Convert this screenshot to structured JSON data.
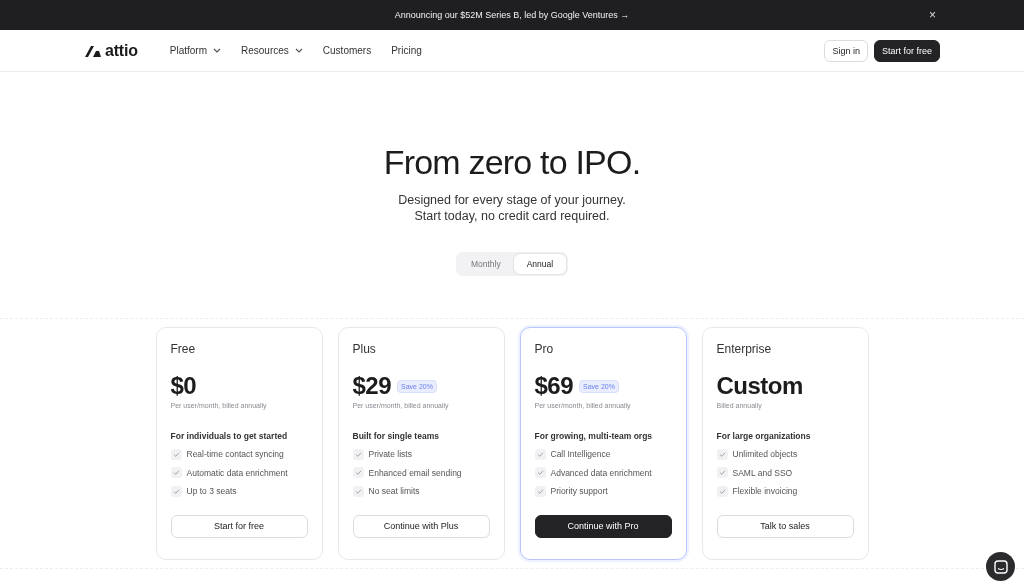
{
  "announcement": {
    "text": "Announcing our $52M Series B, led by Google Ventures",
    "arrow": "→",
    "close": "×"
  },
  "nav": {
    "logo": "attio",
    "items": [
      {
        "label": "Platform",
        "dropdown": true
      },
      {
        "label": "Resources",
        "dropdown": true
      },
      {
        "label": "Customers",
        "dropdown": false
      },
      {
        "label": "Pricing",
        "dropdown": false
      }
    ],
    "buttons": [
      {
        "label": "Sign in",
        "kind": "outline"
      },
      {
        "label": "Start for free",
        "kind": "primary"
      }
    ]
  },
  "hero": {
    "title": "From zero to IPO.",
    "subtitle_lines": [
      "Designed for every stage of your journey.",
      "Start today, no credit card required."
    ]
  },
  "billing_toggle": [
    {
      "label": "Monthly",
      "selected": false
    },
    {
      "label": "Annual",
      "selected": true
    }
  ],
  "plans": [
    {
      "name": "Free",
      "price": "$0",
      "billing": "Per user/month, billed annually",
      "featured": false,
      "tagline": "For individuals to get started",
      "features": [
        "Real-time contact syncing",
        "Automatic data enrichment",
        "Up to 3 seats"
      ],
      "button": {
        "label": "Start for free",
        "kind": "outline"
      }
    },
    {
      "name": "Plus",
      "price": "$29",
      "badge": "Save 20%",
      "billing": "Per user/month, billed annually",
      "featured": false,
      "tagline": "Built for single teams",
      "features": [
        "Private lists",
        "Enhanced email sending",
        "No seat limits"
      ],
      "button": {
        "label": "Continue with Plus",
        "kind": "outline"
      }
    },
    {
      "name": "Pro",
      "price": "$69",
      "badge": "Save 20%",
      "billing": "Per user/month, billed annually",
      "featured": true,
      "tagline": "For growing, multi-team orgs",
      "features": [
        "Call Intelligence",
        "Advanced data enrichment",
        "Priority support"
      ],
      "button": {
        "label": "Continue with Pro",
        "kind": "primary"
      }
    },
    {
      "name": "Enterprise",
      "price": "Custom",
      "billing": "Billed annually",
      "featured": false,
      "tagline": "For large organizations",
      "features": [
        "Unlimited objects",
        "SAML and SSO",
        "Flexible invoicing"
      ],
      "button": {
        "label": "Talk to sales",
        "kind": "outline"
      }
    }
  ]
}
